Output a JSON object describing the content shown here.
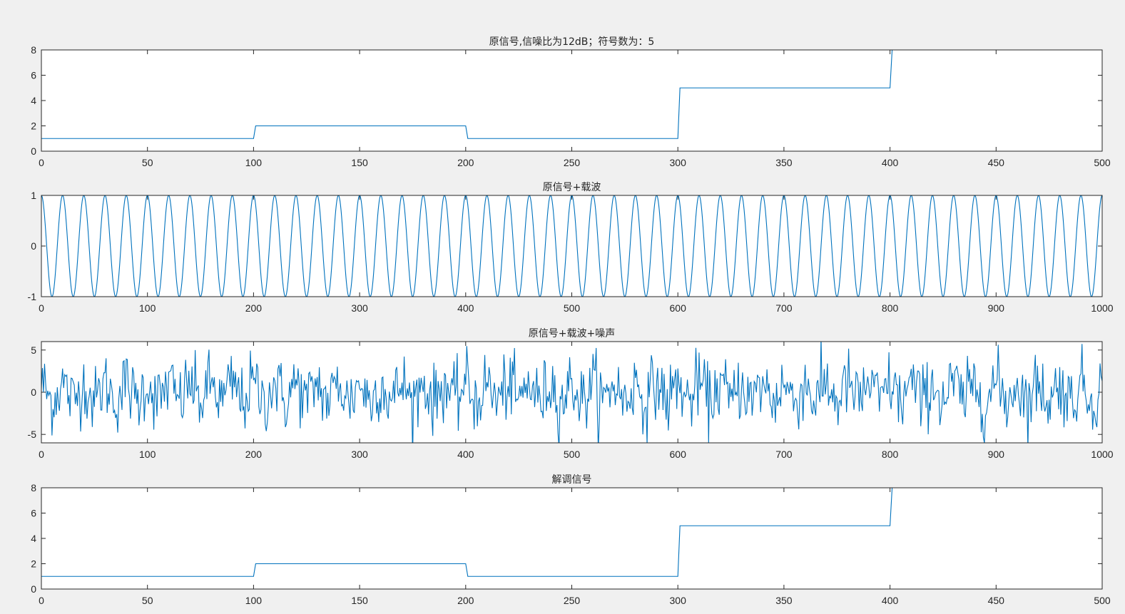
{
  "figure": {
    "background": "#f0f0f0",
    "line_color": "#0072bd"
  },
  "chart_data": [
    {
      "type": "line",
      "title": "原信号,信噪比为12dB；符号数为：5",
      "xlim": [
        0,
        500
      ],
      "ylim": [
        0,
        8
      ],
      "xticks": [
        0,
        50,
        100,
        150,
        200,
        250,
        300,
        350,
        400,
        450,
        500
      ],
      "yticks": [
        0,
        2,
        4,
        6,
        8
      ],
      "series": [
        {
          "x": [
            0,
            100,
            101,
            200,
            201,
            300,
            301,
            400,
            401,
            500
          ],
          "y": [
            1,
            1,
            2,
            2,
            1,
            1,
            5,
            5,
            8,
            8
          ]
        }
      ]
    },
    {
      "type": "line",
      "title": "原信号+载波",
      "xlim": [
        0,
        1000
      ],
      "ylim": [
        -1,
        1
      ],
      "xticks": [
        0,
        100,
        200,
        300,
        400,
        500,
        600,
        700,
        800,
        900,
        1000
      ],
      "yticks": [
        -1,
        0,
        1
      ],
      "series": [
        {
          "function": "cos",
          "amplitude": 1,
          "period": 20,
          "x_range": [
            0,
            1000
          ]
        }
      ]
    },
    {
      "type": "line",
      "title": "原信号+载波+噪声",
      "xlim": [
        0,
        1000
      ],
      "ylim": [
        -6,
        6
      ],
      "xticks": [
        0,
        100,
        200,
        300,
        400,
        500,
        600,
        700,
        800,
        900,
        1000
      ],
      "yticks": [
        -5,
        0,
        5
      ],
      "series": [
        {
          "function": "noisy-cos",
          "amplitude": 1,
          "period": 20,
          "noise_std": 2,
          "x_range": [
            0,
            1000
          ]
        }
      ]
    },
    {
      "type": "line",
      "title": "解调信号",
      "xlim": [
        0,
        500
      ],
      "ylim": [
        0,
        8
      ],
      "xticks": [
        0,
        50,
        100,
        150,
        200,
        250,
        300,
        350,
        400,
        450,
        500
      ],
      "yticks": [
        0,
        2,
        4,
        6,
        8
      ],
      "series": [
        {
          "x": [
            0,
            100,
            101,
            200,
            201,
            300,
            301,
            400,
            401,
            500
          ],
          "y": [
            1,
            1,
            2,
            2,
            1,
            1,
            5,
            5,
            8,
            8
          ]
        }
      ]
    }
  ]
}
